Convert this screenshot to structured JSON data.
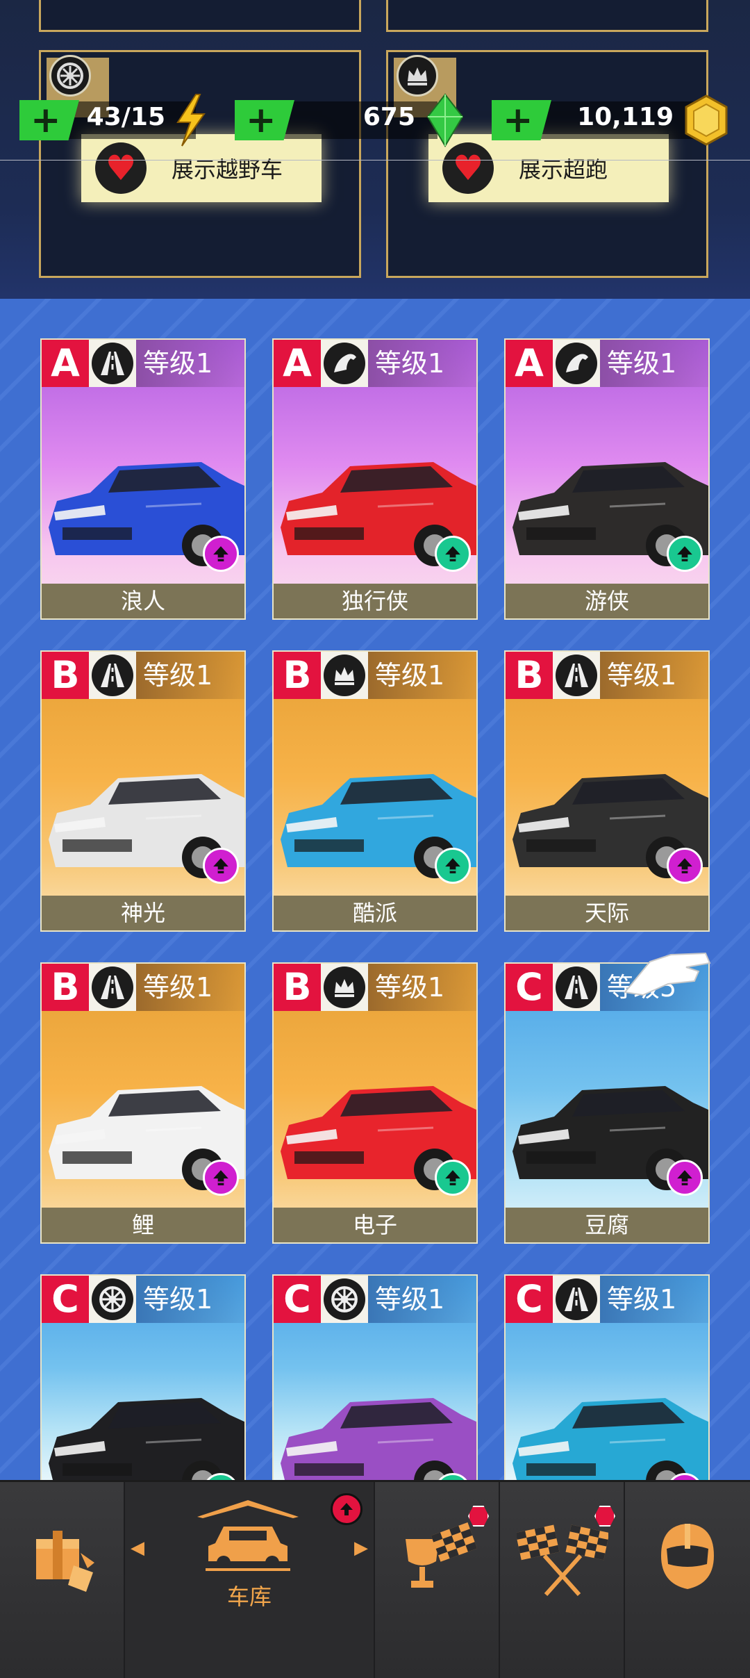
{
  "resources": {
    "energy": {
      "value": "43/15",
      "icon": "lightning-icon"
    },
    "gems": {
      "value": "675",
      "icon": "green-gem-icon"
    },
    "coins": {
      "value": "10,119",
      "icon": "gold-coin-icon"
    }
  },
  "showcase": [
    {
      "label": "展示越野车",
      "icon": "wheel-icon"
    },
    {
      "label": "展示超跑",
      "icon": "crown-icon"
    }
  ],
  "cars": [
    {
      "name": "浪人",
      "class": "A",
      "level": "等级1",
      "type_icon": "road-icon",
      "theme": "pink",
      "upgrade": "magenta",
      "color": "#2a4fd6"
    },
    {
      "name": "独行侠",
      "class": "A",
      "level": "等级1",
      "type_icon": "horse-icon",
      "theme": "pink",
      "upgrade": "green",
      "color": "#e3232a"
    },
    {
      "name": "游侠",
      "class": "A",
      "level": "等级1",
      "type_icon": "horse-icon",
      "theme": "pink",
      "upgrade": "green",
      "color": "#2d2b2a"
    },
    {
      "name": "神光",
      "class": "B",
      "level": "等级1",
      "type_icon": "road-icon",
      "theme": "orange",
      "upgrade": "magenta",
      "color": "#e6e6e6"
    },
    {
      "name": "酷派",
      "class": "B",
      "level": "等级1",
      "type_icon": "crown-icon",
      "theme": "orange",
      "upgrade": "green",
      "color": "#31a7de"
    },
    {
      "name": "天际",
      "class": "B",
      "level": "等级1",
      "type_icon": "road-icon",
      "theme": "orange",
      "upgrade": "magenta",
      "color": "#303030"
    },
    {
      "name": "鲤",
      "class": "B",
      "level": "等级1",
      "type_icon": "road-icon",
      "theme": "orange",
      "upgrade": "magenta",
      "color": "#f2f2f2"
    },
    {
      "name": "电子",
      "class": "B",
      "level": "等级1",
      "type_icon": "crown-icon",
      "theme": "orange",
      "upgrade": "green",
      "color": "#e8242c"
    },
    {
      "name": "豆腐",
      "class": "C",
      "level": "等级5",
      "type_icon": "road-icon",
      "theme": "blue",
      "upgrade": "magenta",
      "color": "#222222"
    },
    {
      "name": "",
      "class": "C",
      "level": "等级1",
      "type_icon": "wheel-icon",
      "theme": "blue",
      "upgrade": "green",
      "color": "#1f1f22"
    },
    {
      "name": "",
      "class": "C",
      "level": "等级1",
      "type_icon": "wheel-icon",
      "theme": "blue",
      "upgrade": "green",
      "color": "#9a4fc4"
    },
    {
      "name": "",
      "class": "C",
      "level": "等级1",
      "type_icon": "road-icon",
      "theme": "blue",
      "upgrade": "magenta",
      "color": "#27a8d4"
    }
  ],
  "nav": {
    "shop_icon": "shop-crate-icon",
    "garage_label": "车库",
    "garage_icon": "garage-car-icon",
    "trophy_icon": "trophy-flag-icon",
    "race_icon": "checkered-flags-icon",
    "profile_icon": "helmet-icon"
  }
}
